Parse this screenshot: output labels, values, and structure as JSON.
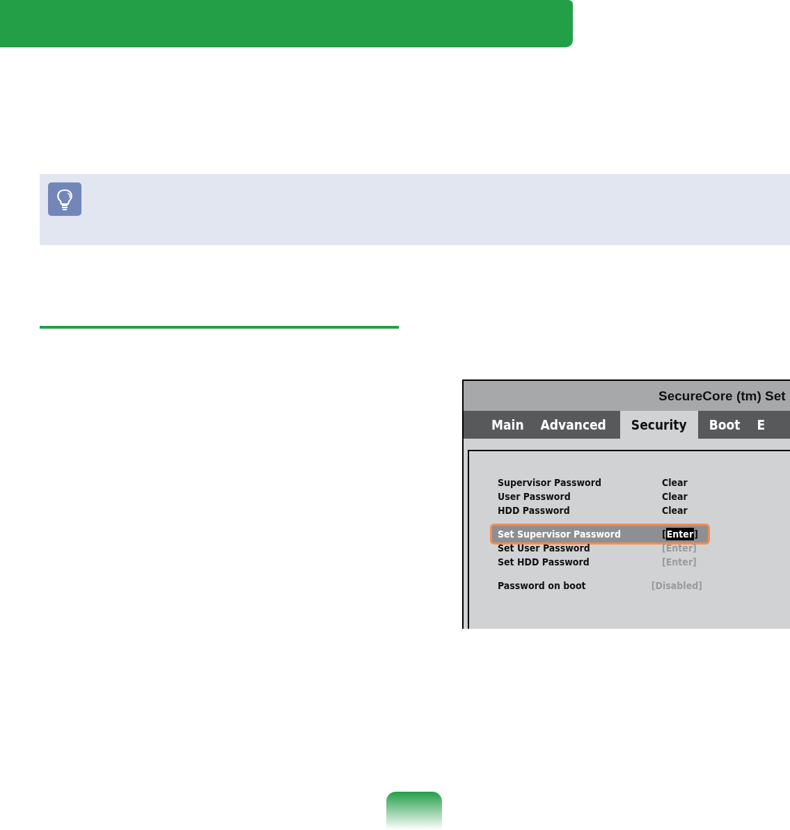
{
  "bios": {
    "title": "SecureCore (tm) Set",
    "tabs": [
      {
        "label": "Main",
        "selected": false
      },
      {
        "label": "Advanced",
        "selected": false
      },
      {
        "label": "Security",
        "selected": true
      },
      {
        "label": "Boot",
        "selected": false
      },
      {
        "label": "E",
        "selected": false
      }
    ],
    "groups": [
      [
        {
          "label": "Supervisor Password",
          "value": "Clear",
          "selected": false,
          "disabled": false
        },
        {
          "label": "User Password",
          "value": "Clear",
          "selected": false,
          "disabled": false
        },
        {
          "label": "HDD Password",
          "value": "Clear",
          "selected": false,
          "disabled": false
        }
      ],
      [
        {
          "label": "Set Supervisor Password",
          "value": "[Enter]",
          "selected": true,
          "disabled": false
        },
        {
          "label": "Set User Password",
          "value": "[Enter]",
          "selected": false,
          "disabled": true
        },
        {
          "label": "Set HDD Password",
          "value": "[Enter]",
          "selected": false,
          "disabled": true
        }
      ],
      [
        {
          "label": "Password on boot",
          "value": "[Disabled]",
          "selected": false,
          "disabled": true
        }
      ]
    ]
  }
}
